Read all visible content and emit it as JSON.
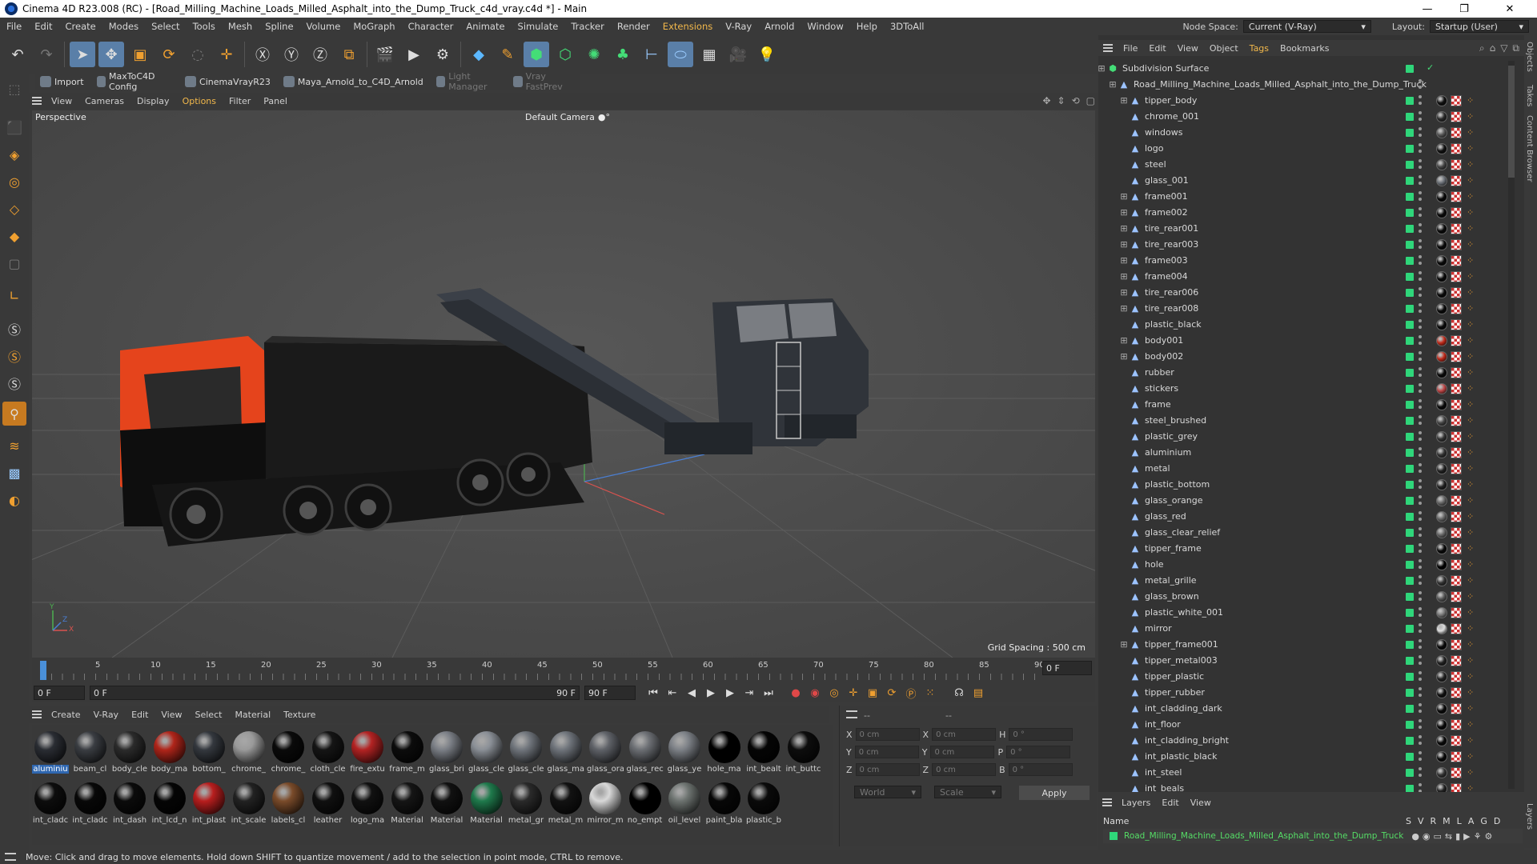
{
  "window": {
    "title": "Cinema 4D R23.008 (RC) - [Road_Milling_Machine_Loads_Milled_Asphalt_into_the_Dump_Truck_c4d_vray.c4d *] - Main",
    "minimize": "—",
    "maximize": "❐",
    "close": "✕"
  },
  "menubar": {
    "items": [
      "File",
      "Edit",
      "Create",
      "Modes",
      "Select",
      "Tools",
      "Mesh",
      "Spline",
      "Volume",
      "MoGraph",
      "Character",
      "Animate",
      "Simulate",
      "Tracker",
      "Render",
      "Extensions",
      "V-Ray",
      "Arnold",
      "Window",
      "Help",
      "3DToAll"
    ],
    "highlight_index": 15,
    "node_space_label": "Node Space:",
    "node_space_value": "Current (V-Ray)",
    "layout_label": "Layout:",
    "layout_value": "Startup (User)"
  },
  "plugbar": {
    "items": [
      "Import",
      "MaxToC4D Config",
      "CinemaVrayR23",
      "Maya_Arnold_to_C4D_Arnold",
      "Light Manager",
      "Vray FastPrev"
    ]
  },
  "viewport": {
    "menu": [
      "View",
      "Cameras",
      "Display",
      "Options",
      "Filter",
      "Panel"
    ],
    "menu_highlight": 3,
    "view_name": "Perspective",
    "camera": "Default Camera",
    "camera_icon": "●°",
    "grid_spacing": "Grid Spacing : 500 cm",
    "axis_y": "Y",
    "axis_x": "X",
    "axis_z": "Z"
  },
  "timeline": {
    "ticks": [
      "0",
      "5",
      "10",
      "15",
      "20",
      "25",
      "30",
      "35",
      "40",
      "45",
      "50",
      "55",
      "60",
      "65",
      "70",
      "75",
      "80",
      "85",
      "90"
    ],
    "current_frame": "0 F",
    "start_frame": "0 F",
    "range_start": "0 F",
    "range_end": "90 F",
    "end_frame": "90 F"
  },
  "materials": {
    "menu": [
      "Create",
      "V-Ray",
      "Edit",
      "View",
      "Select",
      "Material",
      "Texture"
    ],
    "row1": [
      {
        "label": "aluminiu",
        "color": "#2a2d33",
        "selected": true
      },
      {
        "label": "beam_cl",
        "color": "#3a3d42"
      },
      {
        "label": "body_cle",
        "color": "#2b2b2b"
      },
      {
        "label": "body_ma",
        "color": "#b0251a"
      },
      {
        "label": "bottom_",
        "color": "#34383e"
      },
      {
        "label": "chrome_",
        "color": "#9a9a9a"
      },
      {
        "label": "chrome_",
        "color": "#0a0a0a"
      },
      {
        "label": "cloth_cle",
        "color": "#151515"
      },
      {
        "label": "fire_extu",
        "color": "#b32323"
      },
      {
        "label": "frame_m",
        "color": "#0c0c0c"
      },
      {
        "label": "glass_bri",
        "color": "#7b7f86"
      },
      {
        "label": "glass_cle",
        "color": "#8a8f96"
      },
      {
        "label": "glass_cle",
        "color": "#70757c"
      },
      {
        "label": "glass_ma",
        "color": "#6f747b"
      },
      {
        "label": "glass_ora",
        "color": "#5f6268"
      },
      {
        "label": "glass_rec",
        "color": "#6c6f74"
      },
      {
        "label": "glass_ye",
        "color": "#7d8187"
      },
      {
        "label": "hole_ma",
        "color": "#000000"
      },
      {
        "label": "int_bealt",
        "color": "#050505"
      },
      {
        "label": "int_buttc",
        "color": "#0d0d0d"
      }
    ],
    "row2": [
      {
        "label": "int_cladc",
        "color": "#0d0d0d"
      },
      {
        "label": "int_cladc",
        "color": "#080808"
      },
      {
        "label": "int_dash",
        "color": "#0b0b0b"
      },
      {
        "label": "int_lcd_n",
        "color": "#050505"
      },
      {
        "label": "int_plast",
        "color": "#b81e1e"
      },
      {
        "label": "int_scale",
        "color": "#222222"
      },
      {
        "label": "labels_cl",
        "color": "#7a4b2a"
      },
      {
        "label": "leather",
        "color": "#101010"
      },
      {
        "label": "logo_ma",
        "color": "#111111"
      },
      {
        "label": "Material",
        "color": "#151515"
      },
      {
        "label": "Material",
        "color": "#111111"
      },
      {
        "label": "Material",
        "color": "#1f7a4c"
      },
      {
        "label": "metal_gr",
        "color": "#2a2a2a"
      },
      {
        "label": "metal_m",
        "color": "#121212"
      },
      {
        "label": "mirror_m",
        "color": "#d8d8d8"
      },
      {
        "label": "no_empt",
        "color": "#000000"
      },
      {
        "label": "oil_level",
        "color": "#6d7370"
      },
      {
        "label": "paint_bla",
        "color": "#070707"
      },
      {
        "label": "plastic_b",
        "color": "#0a0a0a"
      }
    ]
  },
  "coords": {
    "header_dash1": "--",
    "header_dash2": "--",
    "rows": [
      {
        "a": "X",
        "av": "0 cm",
        "b": "X",
        "bv": "0 cm",
        "c": "H",
        "cv": "0 °"
      },
      {
        "a": "Y",
        "av": "0 cm",
        "b": "Y",
        "bv": "0 cm",
        "c": "P",
        "cv": "0 °"
      },
      {
        "a": "Z",
        "av": "0 cm",
        "b": "Z",
        "bv": "0 cm",
        "c": "B",
        "cv": "0 °"
      }
    ],
    "world": "World",
    "scale": "Scale",
    "apply": "Apply"
  },
  "objects": {
    "menu": [
      "File",
      "Edit",
      "View",
      "Object",
      "Tags",
      "Bookmarks"
    ],
    "menu_highlight": 4,
    "root": "Subdivision Surface",
    "scene": "Road_Milling_Machine_Loads_Milled_Asphalt_into_the_Dump_Truck",
    "items": [
      {
        "name": "tipper_body",
        "expand": true
      },
      {
        "name": "chrome_001",
        "expand": false
      },
      {
        "name": "windows",
        "expand": false
      },
      {
        "name": "logo",
        "expand": false
      },
      {
        "name": "steel",
        "expand": false
      },
      {
        "name": "glass_001",
        "expand": false
      },
      {
        "name": "frame001",
        "expand": true
      },
      {
        "name": "frame002",
        "expand": true
      },
      {
        "name": "tire_rear001",
        "expand": true
      },
      {
        "name": "tire_rear003",
        "expand": true
      },
      {
        "name": "frame003",
        "expand": true
      },
      {
        "name": "frame004",
        "expand": true
      },
      {
        "name": "tire_rear006",
        "expand": true
      },
      {
        "name": "tire_rear008",
        "expand": true
      },
      {
        "name": "plastic_black",
        "expand": false
      },
      {
        "name": "body001",
        "expand": true
      },
      {
        "name": "body002",
        "expand": true
      },
      {
        "name": "rubber",
        "expand": false
      },
      {
        "name": "stickers",
        "expand": false
      },
      {
        "name": "frame",
        "expand": false
      },
      {
        "name": "steel_brushed",
        "expand": false
      },
      {
        "name": "plastic_grey",
        "expand": false
      },
      {
        "name": "aluminium",
        "expand": false
      },
      {
        "name": "metal",
        "expand": false
      },
      {
        "name": "plastic_bottom",
        "expand": false
      },
      {
        "name": "glass_orange",
        "expand": false
      },
      {
        "name": "glass_red",
        "expand": false
      },
      {
        "name": "glass_clear_relief",
        "expand": false
      },
      {
        "name": "tipper_frame",
        "expand": false
      },
      {
        "name": "hole",
        "expand": false
      },
      {
        "name": "metal_grille",
        "expand": false
      },
      {
        "name": "glass_brown",
        "expand": false
      },
      {
        "name": "plastic_white_001",
        "expand": false
      },
      {
        "name": "mirror",
        "expand": false
      },
      {
        "name": "tipper_frame001",
        "expand": true
      },
      {
        "name": "tipper_metal003",
        "expand": false
      },
      {
        "name": "tipper_plastic",
        "expand": false
      },
      {
        "name": "tipper_rubber",
        "expand": false
      },
      {
        "name": "int_cladding_dark",
        "expand": false
      },
      {
        "name": "int_floor",
        "expand": false
      },
      {
        "name": "int_cladding_bright",
        "expand": false
      },
      {
        "name": "int_plastic_black",
        "expand": false
      },
      {
        "name": "int_steel",
        "expand": false
      },
      {
        "name": "int_beals",
        "expand": false
      }
    ]
  },
  "layers": {
    "menu": [
      "Layers",
      "Edit",
      "View"
    ],
    "col_name": "Name",
    "cols": [
      "S",
      "V",
      "R",
      "M",
      "L",
      "A",
      "G",
      "D"
    ],
    "row": "Road_Milling_Machine_Loads_Milled_Asphalt_into_the_Dump_Truck"
  },
  "sidetabs": [
    "Objects",
    "Takes",
    "Content Browser",
    "Layers"
  ],
  "status": "Move: Click and drag to move elements. Hold down SHIFT to quantize movement / add to the selection in point mode, CTRL to remove."
}
